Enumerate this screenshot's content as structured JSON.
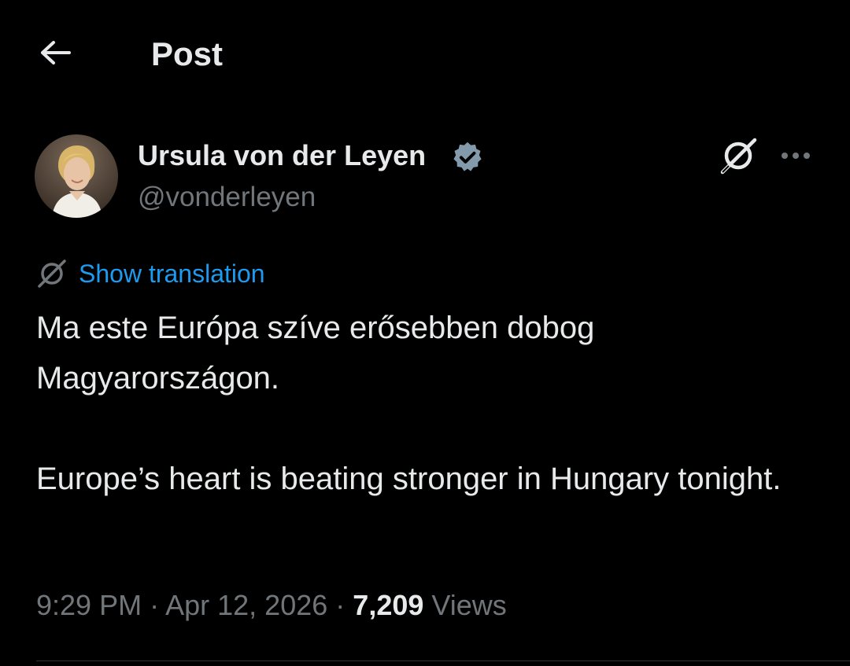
{
  "header": {
    "title": "Post",
    "back_icon": "arrow-left-icon"
  },
  "post": {
    "author": {
      "name": "Ursula von der Leyen",
      "handle": "@vonderleyen",
      "verified_icon": "verified-badge-icon",
      "verified_color": "#829aab"
    },
    "grok_icon": "grok-icon",
    "more_icon": "more-horizontal-icon",
    "translation": {
      "icon": "grok-translate-icon",
      "label": "Show translation"
    },
    "text": {
      "paragraph_1": "Ma este Európa szíve erősebben dobog Magyarországon.",
      "paragraph_2": "Europe’s heart is beating stronger in Hungary tonight."
    },
    "meta": {
      "time": "9:29 PM",
      "separator": "·",
      "date": "Apr 12, 2026",
      "views_count": "7,209",
      "views_label": "Views"
    }
  },
  "colors": {
    "background": "#000000",
    "text_primary": "#e7e9ea",
    "text_secondary": "#71767b",
    "link": "#1d9bf0",
    "divider": "#2f3336"
  }
}
